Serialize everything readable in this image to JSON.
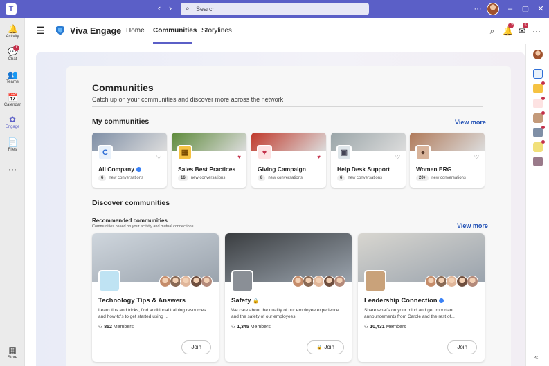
{
  "titlebar": {
    "back_icon": "‹",
    "forward_icon": "›",
    "search_placeholder": "Search",
    "more_icon": "···",
    "minimize_icon": "–",
    "maximize_icon": "▢",
    "close_icon": "✕"
  },
  "rail": {
    "items": [
      {
        "label": "Activity",
        "icon": "🔔"
      },
      {
        "label": "Chat",
        "icon": "💬",
        "badge": "1"
      },
      {
        "label": "Teams",
        "icon": "👥"
      },
      {
        "label": "Calendar",
        "icon": "📅"
      },
      {
        "label": "Engage",
        "icon": "✿"
      },
      {
        "label": "Files",
        "icon": "📄"
      },
      {
        "label": "",
        "icon": "···"
      },
      {
        "label": "Store",
        "icon": "▦"
      }
    ]
  },
  "app": {
    "title": "Viva Engage",
    "nav": [
      "Home",
      "Communities",
      "Storylines"
    ],
    "notif_badge": "12",
    "inbox_badge": "5"
  },
  "page": {
    "title": "Communities",
    "subtitle": "Catch up on your communities and discover more across the network",
    "my_title": "My communities",
    "view_more": "View more",
    "discover_title": "Discover communities",
    "recommended_title": "Recommended communities",
    "recommended_sub": "Communities based on your activity and mutual connections",
    "view_more_2": "View more"
  },
  "my_communities": [
    {
      "name": "All Company",
      "count": "6",
      "count_label": "new conversations",
      "verified": true,
      "liked": false,
      "logo": "C",
      "colors": {
        "banner": "#7f8fa6",
        "logo_bg": "#e8f1fb",
        "logo_fg": "#2f6fd6"
      }
    },
    {
      "name": "Sales Best Practices",
      "count": "16",
      "count_label": "new conversations",
      "verified": false,
      "liked": true,
      "logo": "▦",
      "colors": {
        "banner": "#5d8a3a",
        "logo_bg": "#f5c242",
        "logo_fg": "#7a4b00"
      }
    },
    {
      "name": "Giving Campaign",
      "count": "8",
      "count_label": "new conversations",
      "verified": false,
      "liked": true,
      "logo": "♥",
      "colors": {
        "banner": "#c0392b",
        "logo_bg": "#fde2e2",
        "logo_fg": "#c4314b"
      }
    },
    {
      "name": "Help Desk Support",
      "count": "6",
      "count_label": "new conversations",
      "verified": false,
      "liked": false,
      "logo": "▣",
      "colors": {
        "banner": "#9aa5a8",
        "logo_bg": "#dfe6ea",
        "logo_fg": "#445"
      }
    },
    {
      "name": "Women ERG",
      "count": "20+",
      "count_label": "new conversations",
      "verified": false,
      "liked": false,
      "logo": "●",
      "colors": {
        "banner": "#b07a5a",
        "logo_bg": "#d8b39a",
        "logo_fg": "#5a3a2a"
      }
    }
  ],
  "discover": [
    {
      "name": "Technology Tips & Answers",
      "desc": "Learn tips and tricks, find additional training resources and how-to's to get started using ...",
      "members": "852",
      "members_label": "Members",
      "join": "Join",
      "private": false,
      "verified": false,
      "colors": {
        "photo": "#cfd6dd",
        "logo": "#bfe3f3"
      }
    },
    {
      "name": "Safety",
      "desc": "We care about the quality of our employee experience and the safety of our employees.",
      "members": "1,345",
      "members_label": "Members",
      "join": "Join",
      "private": true,
      "verified": false,
      "colors": {
        "photo": "#3a3d40",
        "logo": "#8a8f96"
      }
    },
    {
      "name": "Leadership Connection",
      "desc": "Share what's on your mind and get important announcements from Carole and the rest of...",
      "members": "10,431",
      "members_label": "Members",
      "join": "Join",
      "private": false,
      "verified": true,
      "colors": {
        "photo": "#d8d6d0",
        "logo": "#c9a27a"
      }
    }
  ],
  "right_rail": {
    "collapse_icon": "«"
  }
}
